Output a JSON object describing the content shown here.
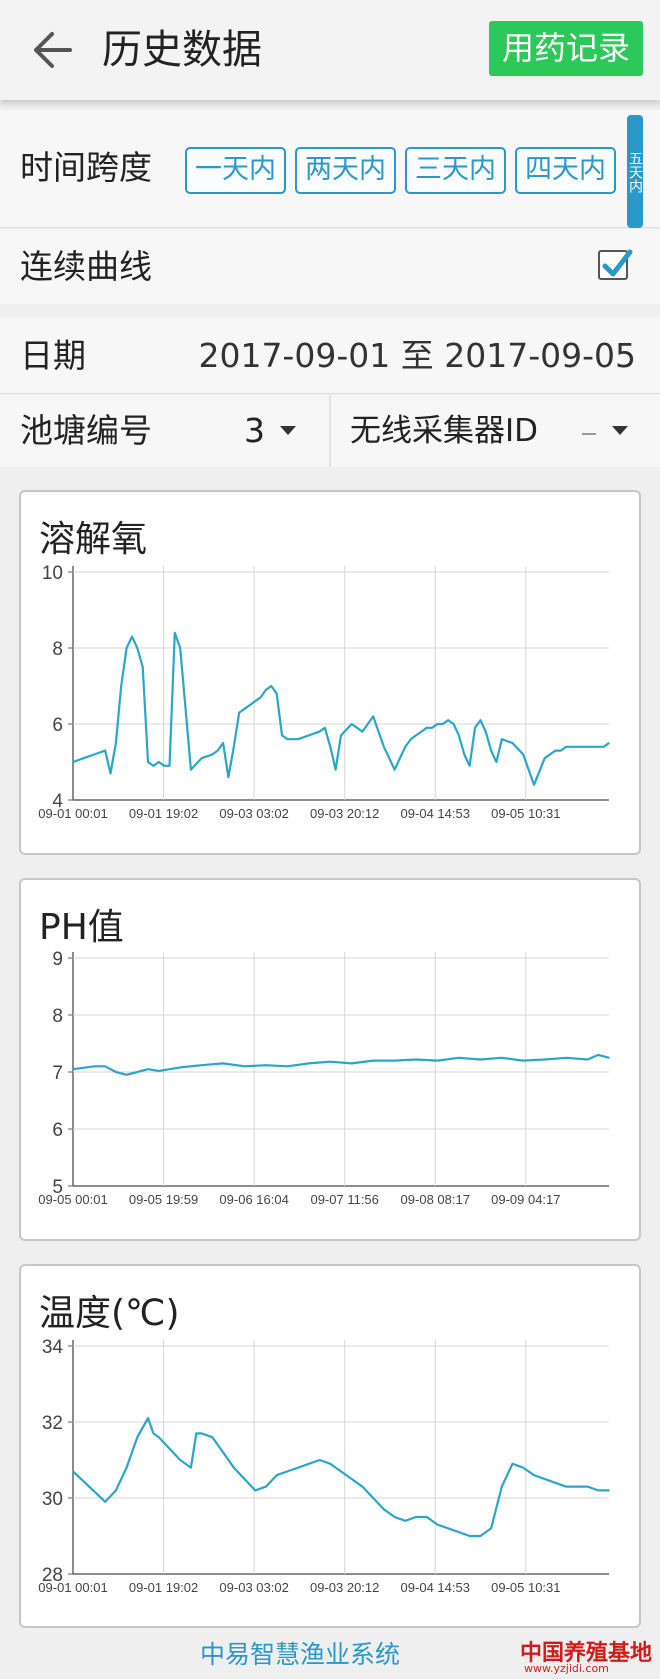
{
  "header": {
    "title": "历史数据",
    "medication_button": "用药记录",
    "back_icon": "arrow-left-icon"
  },
  "time_span": {
    "label": "时间跨度",
    "options": [
      "一天内",
      "两天内",
      "三天内",
      "四天内",
      "五天内"
    ]
  },
  "continuous": {
    "label": "连续曲线",
    "checked": true
  },
  "date": {
    "label": "日期",
    "value": "2017-09-01 至 2017-09-05"
  },
  "pond": {
    "label": "池塘编号",
    "value": "3"
  },
  "collector": {
    "label": "无线采集器ID",
    "value": ""
  },
  "colors": {
    "accent": "#2a98c8",
    "green_button": "#2dc85a",
    "line": "#2aa6c8"
  },
  "chart_data": [
    {
      "type": "line",
      "title": "溶解氧",
      "ylim": [
        4,
        10
      ],
      "yticks": [
        4,
        6,
        8,
        10
      ],
      "xticks": [
        "09-01 00:01",
        "09-01 19:02",
        "09-03 03:02",
        "09-03 20:12",
        "09-04 14:53",
        "09-05 10:31"
      ],
      "grid": true,
      "series": [
        {
          "x": [
            0,
            2,
            4,
            6,
            7,
            8,
            9,
            10,
            11,
            12,
            13,
            14,
            15,
            16,
            17,
            18,
            19,
            20,
            22,
            24,
            26,
            27,
            28,
            29,
            30,
            31,
            32,
            33,
            34,
            35,
            36,
            37,
            38,
            39,
            40,
            42,
            44,
            46,
            47,
            48,
            49,
            50,
            52,
            54,
            56,
            58,
            60,
            62,
            63,
            64,
            65,
            66,
            67,
            68,
            69,
            70,
            71,
            72,
            73,
            74,
            75,
            76,
            77,
            78,
            79,
            80,
            82,
            84,
            86,
            88,
            89,
            90,
            91,
            92,
            93,
            94,
            96,
            98,
            99,
            100
          ],
          "y": [
            5.0,
            5.1,
            5.2,
            5.3,
            4.7,
            5.5,
            7.0,
            8.0,
            8.3,
            8.0,
            7.5,
            5.0,
            4.9,
            5.0,
            4.9,
            4.9,
            8.4,
            8.0,
            4.8,
            5.1,
            5.2,
            5.3,
            5.5,
            4.6,
            5.4,
            6.3,
            6.4,
            6.5,
            6.6,
            6.7,
            6.9,
            7.0,
            6.8,
            5.7,
            5.6,
            5.6,
            5.7,
            5.8,
            5.9,
            5.4,
            4.8,
            5.7,
            6.0,
            5.8,
            6.2,
            5.4,
            4.8,
            5.4,
            5.6,
            5.7,
            5.8,
            5.9,
            5.9,
            6.0,
            6.0,
            6.1,
            6.0,
            5.7,
            5.2,
            4.9,
            5.9,
            6.1,
            5.8,
            5.3,
            5.0,
            5.6,
            5.5,
            5.2,
            4.4,
            5.1,
            5.2,
            5.3,
            5.3,
            5.4,
            5.4,
            5.4,
            5.4,
            5.4,
            5.4,
            5.5
          ]
        }
      ]
    },
    {
      "type": "line",
      "title": "PH值",
      "ylim": [
        5,
        9
      ],
      "yticks": [
        5,
        6,
        7,
        8,
        9
      ],
      "xticks": [
        "09-05 00:01",
        "09-05 19:59",
        "09-06 16:04",
        "09-07 11:56",
        "09-08 08:17",
        "09-09 04:17"
      ],
      "grid": true,
      "series": [
        {
          "x": [
            0,
            4,
            6,
            8,
            10,
            12,
            14,
            16,
            18,
            20,
            24,
            28,
            32,
            36,
            40,
            44,
            48,
            52,
            56,
            60,
            64,
            68,
            72,
            76,
            80,
            84,
            88,
            92,
            96,
            98,
            100
          ],
          "y": [
            7.05,
            7.1,
            7.1,
            7.0,
            6.95,
            7.0,
            7.05,
            7.02,
            7.05,
            7.08,
            7.12,
            7.15,
            7.1,
            7.12,
            7.1,
            7.15,
            7.18,
            7.15,
            7.2,
            7.2,
            7.22,
            7.2,
            7.25,
            7.22,
            7.25,
            7.2,
            7.22,
            7.25,
            7.22,
            7.3,
            7.25
          ]
        }
      ]
    },
    {
      "type": "line",
      "title": "温度(℃)",
      "ylim": [
        28,
        34
      ],
      "yticks": [
        28,
        30,
        32,
        34
      ],
      "xticks": [
        "09-01 00:01",
        "09-01 19:02",
        "09-03 03:02",
        "09-03 20:12",
        "09-04 14:53",
        "09-05 10:31"
      ],
      "grid": true,
      "series": [
        {
          "x": [
            0,
            3,
            6,
            8,
            10,
            12,
            14,
            15,
            16,
            18,
            20,
            22,
            23,
            24,
            26,
            28,
            30,
            32,
            34,
            36,
            38,
            40,
            42,
            44,
            46,
            48,
            50,
            52,
            54,
            56,
            58,
            60,
            62,
            64,
            66,
            68,
            70,
            72,
            74,
            76,
            78,
            80,
            82,
            84,
            86,
            88,
            90,
            92,
            94,
            96,
            98,
            100
          ],
          "y": [
            30.7,
            30.3,
            29.9,
            30.2,
            30.8,
            31.6,
            32.1,
            31.7,
            31.6,
            31.3,
            31.0,
            30.8,
            31.7,
            31.7,
            31.6,
            31.2,
            30.8,
            30.5,
            30.2,
            30.3,
            30.6,
            30.7,
            30.8,
            30.9,
            31.0,
            30.9,
            30.7,
            30.5,
            30.3,
            30.0,
            29.7,
            29.5,
            29.4,
            29.5,
            29.5,
            29.3,
            29.2,
            29.1,
            29.0,
            29.0,
            29.2,
            30.3,
            30.9,
            30.8,
            30.6,
            30.5,
            30.4,
            30.3,
            30.3,
            30.3,
            30.2,
            30.2
          ]
        }
      ]
    }
  ],
  "footer": {
    "text": "中易智慧渔业系统",
    "watermark": "中国养殖基地",
    "watermark_url": "www.yzjidi.com"
  }
}
